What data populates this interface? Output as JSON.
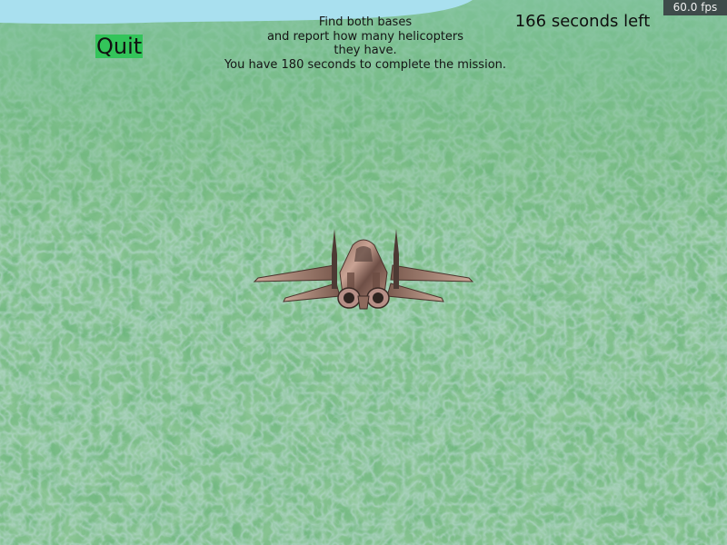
{
  "hud": {
    "quit_label": "Quit",
    "timer_text": "166 seconds left",
    "fps_text": "60.0 fps",
    "mission_lines": [
      "Find both bases",
      "and report how many helicopters",
      "they have.",
      "You have 180 seconds to complete the mission."
    ]
  },
  "colors": {
    "water": "#a9e0ef",
    "grass": "#5fae63",
    "quit_button_bg": "#33c45a",
    "fps_bg": "#3e4b4a"
  },
  "icons": {
    "player": "fighter-jet-icon"
  }
}
